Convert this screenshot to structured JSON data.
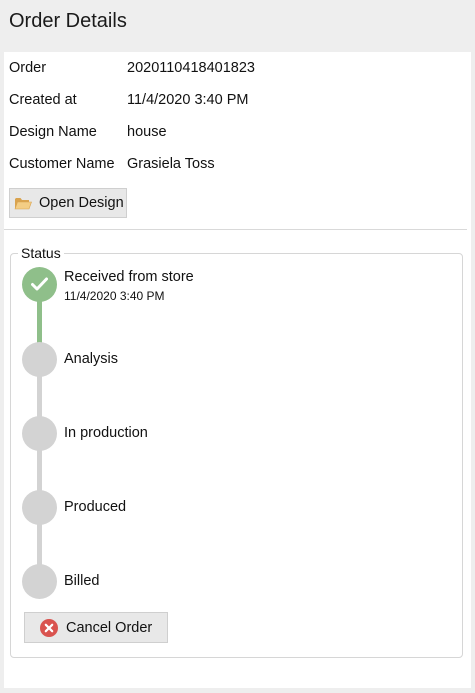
{
  "header": {
    "title": "Order Details"
  },
  "fields": [
    {
      "label": "Order",
      "value": "2020110418401823"
    },
    {
      "label": "Created at",
      "value": "11/4/2020 3:40 PM"
    },
    {
      "label": "Design Name",
      "value": "house"
    },
    {
      "label": "Customer Name",
      "value": "Grasiela Toss"
    }
  ],
  "open_design": {
    "label": "Open Design",
    "icon": "folder-icon"
  },
  "status": {
    "legend": "Status",
    "steps": [
      {
        "label": "Received from store",
        "time": "11/4/2020 3:40 PM",
        "done": true
      },
      {
        "label": "Analysis",
        "done": false
      },
      {
        "label": "In production",
        "done": false
      },
      {
        "label": "Produced",
        "done": false
      },
      {
        "label": "Billed",
        "done": false
      }
    ]
  },
  "cancel": {
    "label": "Cancel Order",
    "icon": "cancel-icon"
  },
  "colors": {
    "done": "#8fbf8a",
    "pending": "#d3d3d3",
    "cancel_icon": "#d9534f",
    "folder": "#e7b86a"
  }
}
